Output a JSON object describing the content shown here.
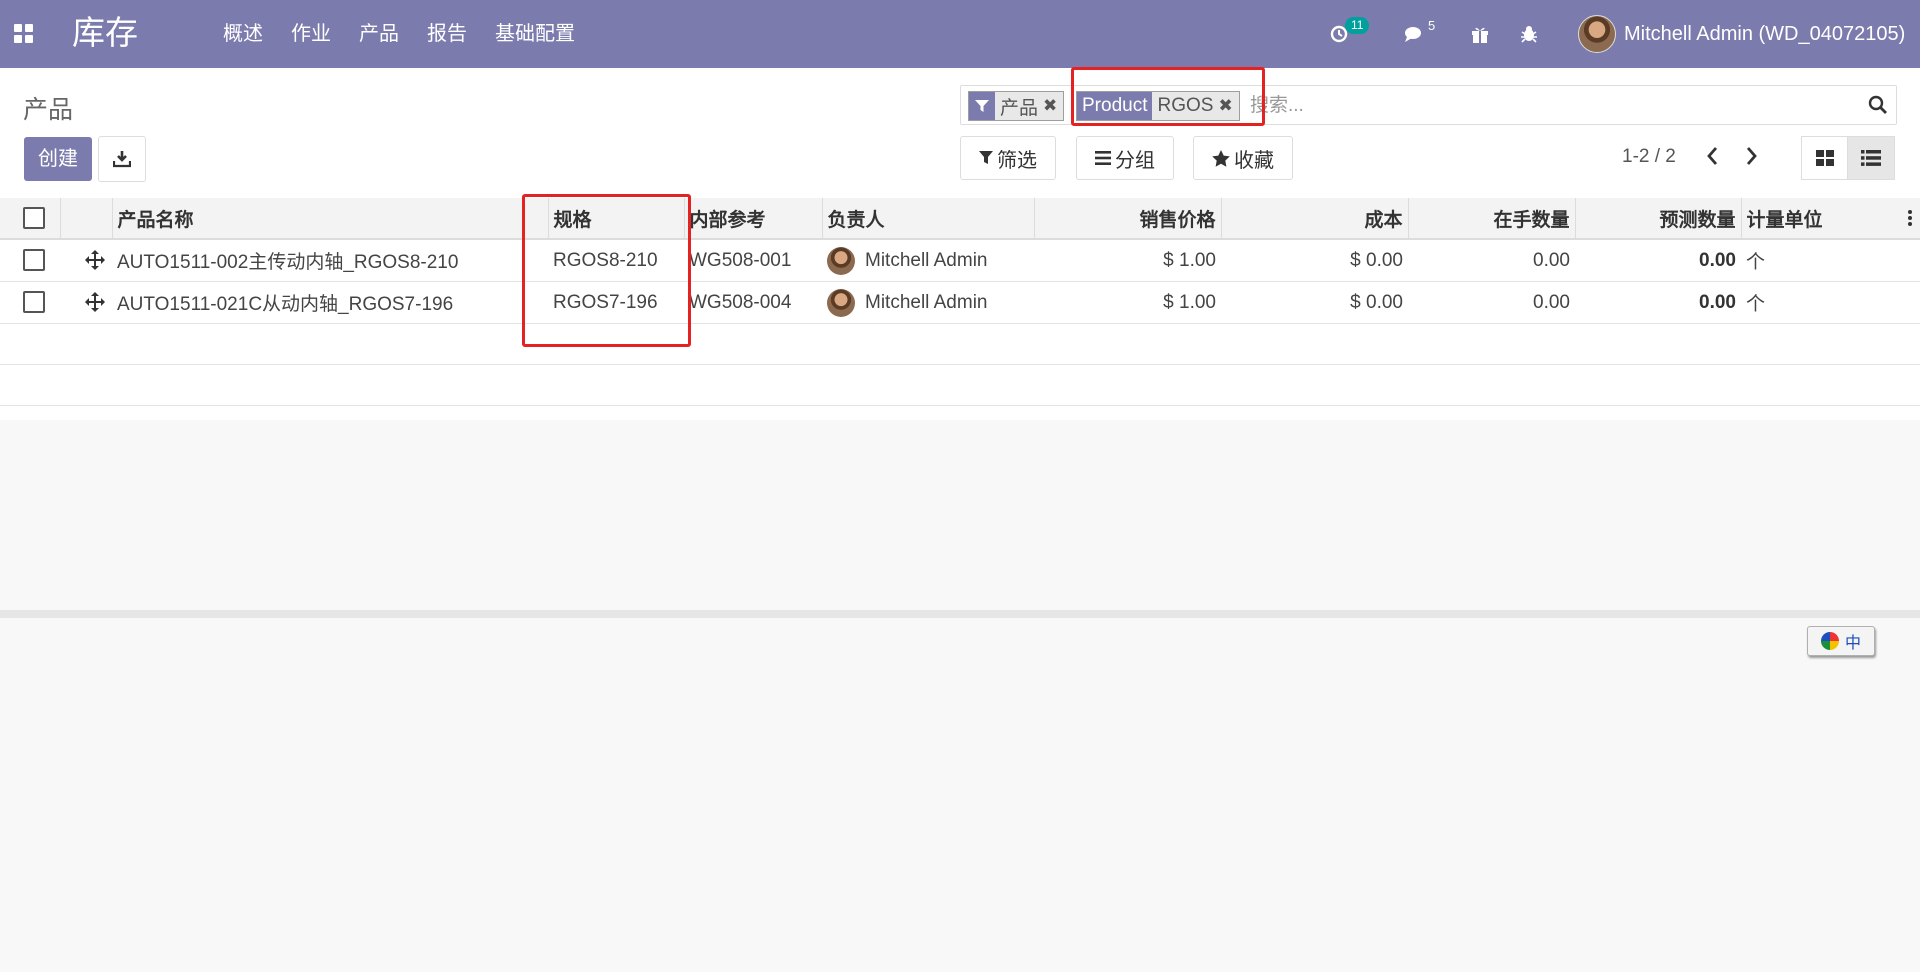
{
  "navbar": {
    "app_title": "库存",
    "menu": [
      "概述",
      "作业",
      "产品",
      "报告",
      "基础配置"
    ],
    "activity_count": "11",
    "messages_count": "5",
    "user_name": "Mitchell Admin (WD_04072105)"
  },
  "control": {
    "breadcrumb": "产品",
    "create_label": "创建",
    "search": {
      "facet_filter_value": "产品",
      "facet_field_label": "Product",
      "facet_field_value": "RGOS",
      "placeholder": "搜索..."
    },
    "filters_label": "筛选",
    "groupby_label": "分组",
    "favorites_label": "收藏",
    "pager": "1-2 / 2"
  },
  "table": {
    "headers": {
      "name": "产品名称",
      "spec": "规格",
      "ref": "内部参考",
      "responsible": "负责人",
      "price": "销售价格",
      "cost": "成本",
      "onhand": "在手数量",
      "forecast": "预测数量",
      "uom": "计量单位"
    },
    "rows": [
      {
        "name": "AUTO1511-002主传动内轴_RGOS8-210",
        "spec": "RGOS8-210",
        "ref": "WG508-001",
        "responsible": "Mitchell Admin",
        "price": "$ 1.00",
        "cost": "$ 0.00",
        "onhand": "0.00",
        "forecast": "0.00",
        "uom": "个"
      },
      {
        "name": "AUTO1511-021C从动内轴_RGOS7-196",
        "spec": "RGOS7-196",
        "ref": "WG508-004",
        "responsible": "Mitchell Admin",
        "price": "$ 1.00",
        "cost": "$ 0.00",
        "onhand": "0.00",
        "forecast": "0.00",
        "uom": "个"
      }
    ]
  },
  "ime": {
    "label": "中"
  },
  "colors": {
    "brand": "#7c7bad",
    "highlight": "#e42222",
    "badge": "#00a09d"
  }
}
